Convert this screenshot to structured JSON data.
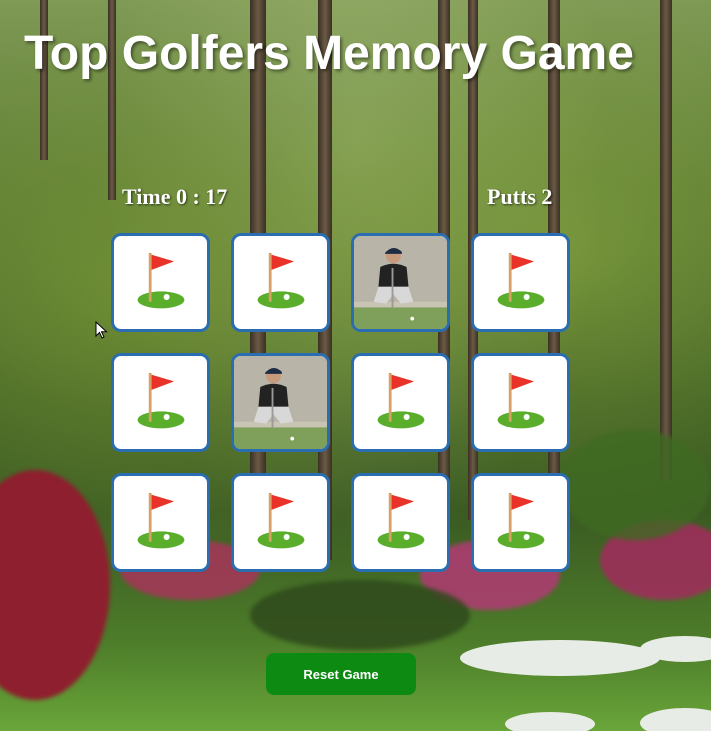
{
  "header": {
    "title": "Top Golfers Memory Game"
  },
  "stats": {
    "time": "Time 0 : 17",
    "putts": "Putts 2"
  },
  "cards": [
    {
      "state": "face-down",
      "icon": "golf-flag-icon"
    },
    {
      "state": "face-down",
      "icon": "golf-flag-icon"
    },
    {
      "state": "face-up",
      "icon": "golfer-photo"
    },
    {
      "state": "face-down",
      "icon": "golf-flag-icon"
    },
    {
      "state": "face-down",
      "icon": "golf-flag-icon"
    },
    {
      "state": "face-up",
      "icon": "golfer-photo"
    },
    {
      "state": "face-down",
      "icon": "golf-flag-icon"
    },
    {
      "state": "face-down",
      "icon": "golf-flag-icon"
    },
    {
      "state": "face-down",
      "icon": "golf-flag-icon"
    },
    {
      "state": "face-down",
      "icon": "golf-flag-icon"
    },
    {
      "state": "face-down",
      "icon": "golf-flag-icon"
    },
    {
      "state": "face-down",
      "icon": "golf-flag-icon"
    }
  ],
  "controls": {
    "reset_label": "Reset Game"
  },
  "colors": {
    "card_border": "#2a6db0",
    "reset_button": "#0d8a12",
    "flag": "#e8322a",
    "green": "#5aae2c"
  }
}
